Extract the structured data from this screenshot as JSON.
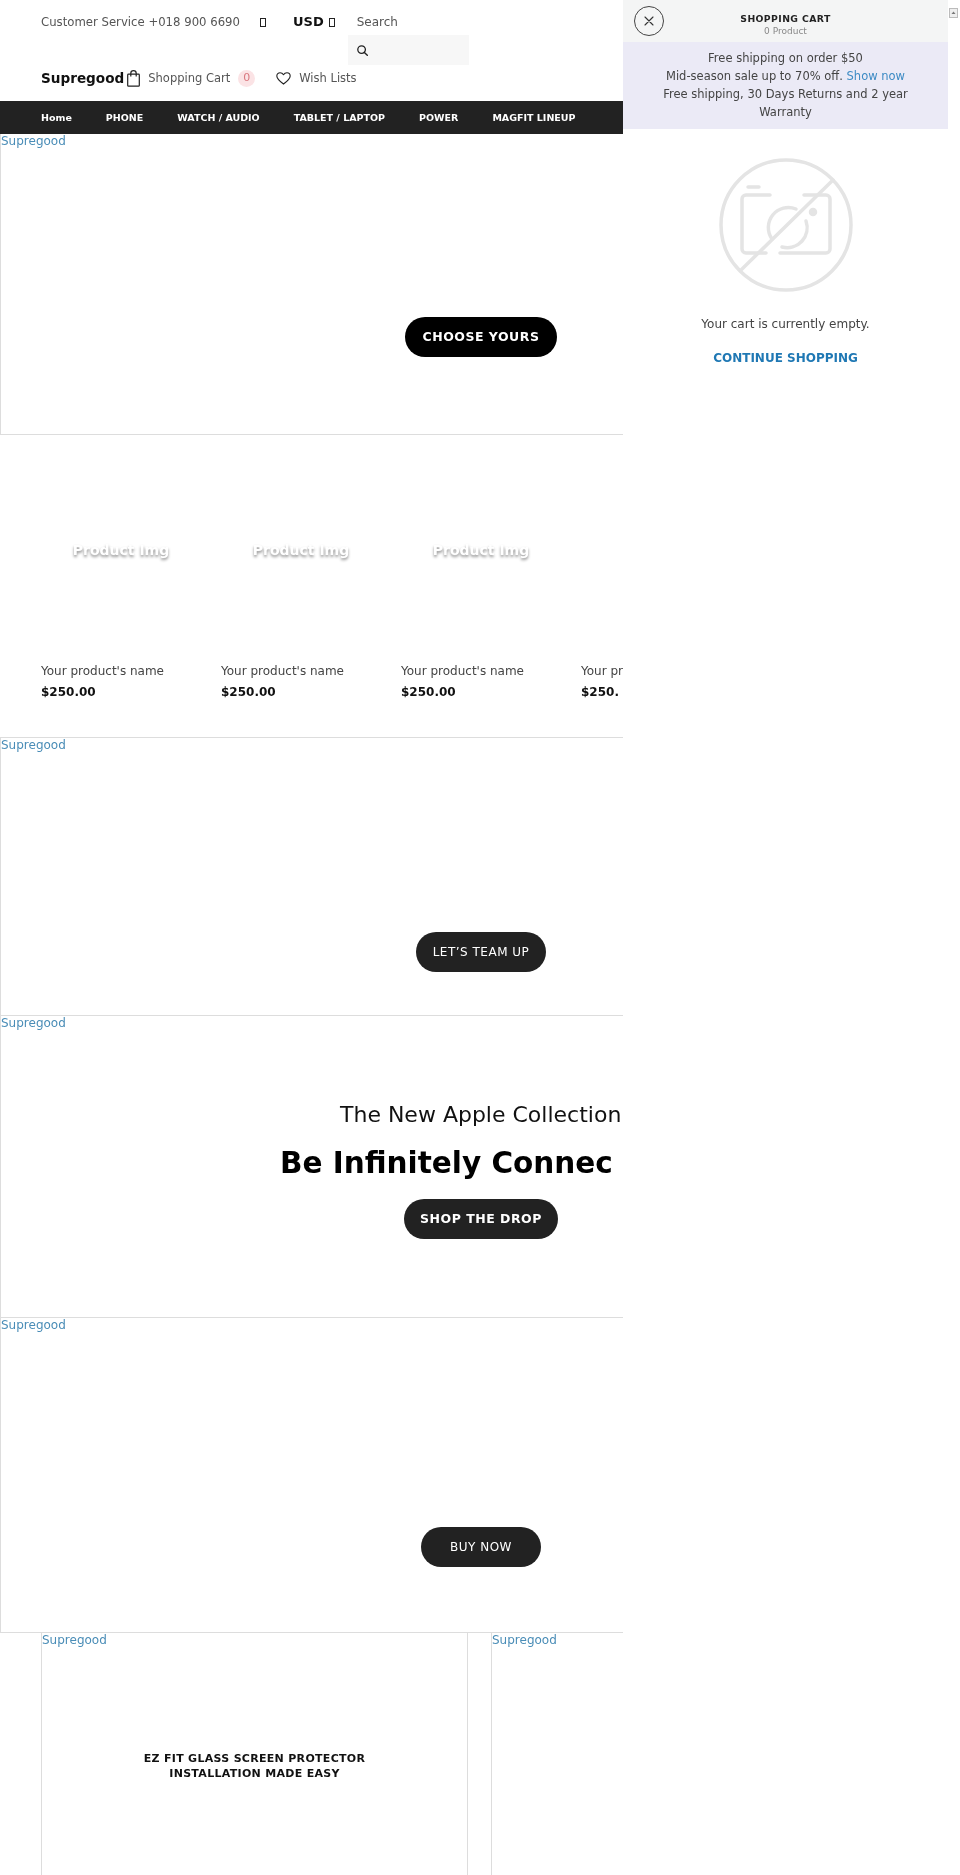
{
  "header": {
    "customer_service": "Customer Service +018 900 6690",
    "currency": "USD",
    "search": {
      "label": "Search"
    },
    "logo": "Supregood",
    "cart": {
      "label": "Shopping Cart",
      "count": "0"
    },
    "wishlist": {
      "label": "Wish Lists"
    }
  },
  "nav": [
    {
      "label": "Home"
    },
    {
      "label": "PHONE"
    },
    {
      "label": "WATCH / AUDIO"
    },
    {
      "label": "TABLET / LAPTOP"
    },
    {
      "label": "POWER"
    },
    {
      "label": "MAGFIT LINEUP"
    }
  ],
  "hero_banner": {
    "image_alt": "Supregood",
    "button": "CHOOSE YOURS"
  },
  "products": [
    {
      "image_label": "Product Img",
      "name": "Your product's name",
      "price": "$250.00"
    },
    {
      "image_label": "Product Img",
      "name": "Your product's name",
      "price": "$250.00"
    },
    {
      "image_label": "Product Img",
      "name": "Your product's name",
      "price": "$250.00"
    },
    {
      "name": "Your pr",
      "price": "$250."
    }
  ],
  "banners": [
    {
      "kind": "button",
      "image_alt": "Supregood",
      "button": "LET’S TEAM UP"
    },
    {
      "kind": "headline",
      "image_alt": "Supregood",
      "eyebrow": "The New Apple Collection",
      "title": "Be Infinitely Connec",
      "button": "SHOP THE DROP"
    },
    {
      "kind": "button",
      "image_alt": "Supregood",
      "button": "BUY NOW"
    }
  ],
  "promo_cards": [
    {
      "image_alt": "Supregood",
      "title": "EZ FIT GLASS SCREEN PROTECTOR INSTALLATION MADE EASY"
    },
    {
      "image_alt": "Supregood"
    }
  ],
  "cart_drawer": {
    "title": "SHOPPING CART",
    "count": "0 Product",
    "notices": [
      {
        "text": "Free shipping on order $50"
      },
      {
        "text": "Mid-season sale up to 70% off.",
        "link": "Show now"
      },
      {
        "text": "Free shipping, 30 Days Returns and 2 year Warranty"
      }
    ],
    "empty_message": "Your cart is currently empty.",
    "continue_label": "CONTINUE SHOPPING"
  }
}
